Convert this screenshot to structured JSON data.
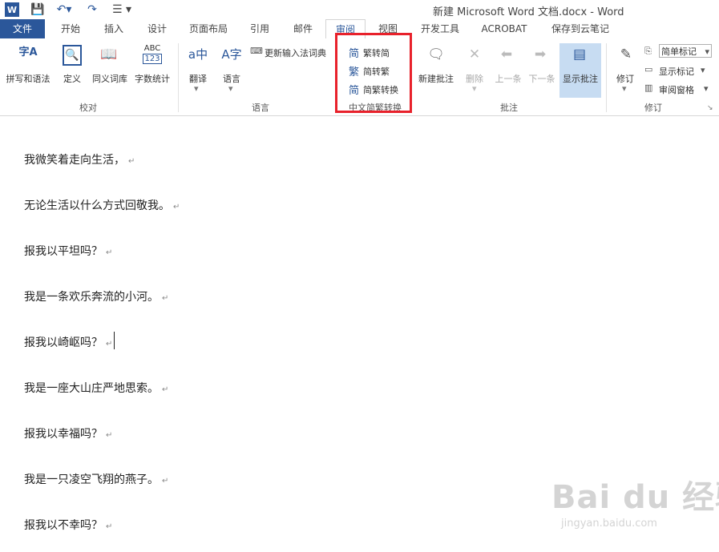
{
  "window": {
    "title": "新建 Microsoft Word 文档.docx - Word"
  },
  "tabs": [
    "文件",
    "开始",
    "插入",
    "设计",
    "页面布局",
    "引用",
    "邮件",
    "审阅",
    "视图",
    "开发工具",
    "ACROBAT",
    "保存到云笔记"
  ],
  "groups": {
    "proofing": {
      "label": "校对",
      "buttons": [
        "拼写和语法",
        "定义",
        "同义词库",
        "字数统计"
      ]
    },
    "language": {
      "label": "语言",
      "buttons": [
        "翻译",
        "语言"
      ],
      "ime_dict": "更新输入法词典"
    },
    "chinese": {
      "label": "中文简繁转换",
      "items": [
        "繁转简",
        "简转繁",
        "简繁转换"
      ]
    },
    "comments": {
      "label": "批注",
      "buttons": [
        "新建批注",
        "删除",
        "上一条",
        "下一条",
        "显示批注"
      ]
    },
    "tracking": {
      "label": "修订",
      "track": "修订",
      "markup": "简单标记",
      "show_markup": "显示标记",
      "pane": "审阅窗格"
    }
  },
  "document": {
    "paragraphs": [
      "我微笑着走向生活，",
      "无论生活以什么方式回敬我。",
      "报我以平坦吗？",
      "我是一条欢乐奔流的小河。",
      "报我以崎岖吗？",
      "我是一座大山庄严地思索。",
      "报我以幸福吗？",
      "我是一只凌空飞翔的燕子。",
      "报我以不幸吗？"
    ]
  },
  "watermark": {
    "brand": "Bai du 经验",
    "url": "jingyan.baidu.com"
  },
  "colors": {
    "file_tab": "#2b579a",
    "highlight": "#e8212b",
    "selected": "#c7dcf2"
  }
}
